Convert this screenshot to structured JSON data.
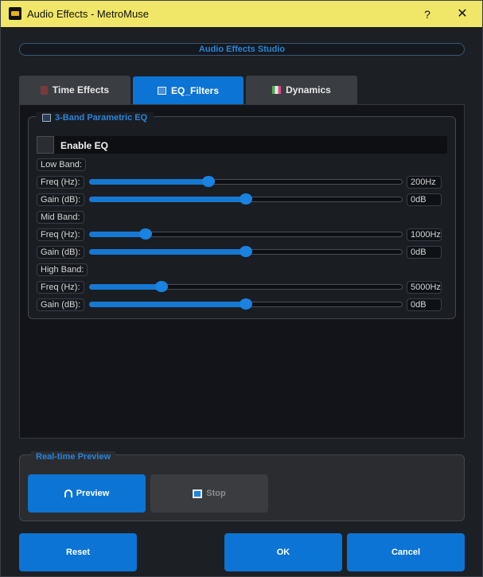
{
  "window": {
    "title": "Audio Effects - MetroMuse",
    "help_label": "?",
    "close_label": "✕"
  },
  "header": {
    "title": "Audio Effects Studio"
  },
  "tabs": [
    {
      "label": "Time Effects",
      "icon": "hourglass-icon",
      "selected": false
    },
    {
      "label": "EQ_Filters",
      "icon": "equalizer-icon",
      "selected": true
    },
    {
      "label": "Dynamics",
      "icon": "dynamics-icon",
      "selected": false
    }
  ],
  "eq": {
    "group_title": "3-Band Parametric EQ",
    "enable_label": "Enable EQ",
    "enabled": false,
    "low": {
      "band_label": "Low Band:",
      "freq_label": "Freq (Hz):",
      "freq_value": "200Hz",
      "freq_level": 0.38,
      "gain_label": "Gain (dB):",
      "gain_value": "0dB",
      "gain_level": 0.5
    },
    "mid": {
      "band_label": "Mid Band:",
      "freq_label": "Freq (Hz):",
      "freq_value": "1000Hz",
      "freq_level": 0.18,
      "gain_label": "Gain (dB):",
      "gain_value": "0dB",
      "gain_level": 0.5
    },
    "high": {
      "band_label": "High Band:",
      "freq_label": "Freq (Hz):",
      "freq_value": "5000Hz",
      "freq_level": 0.23,
      "gain_label": "Gain (dB):",
      "gain_value": "0dB",
      "gain_level": 0.5
    }
  },
  "preview": {
    "group_title": "Real-time Preview",
    "preview_label": "Preview",
    "stop_label": "Stop"
  },
  "footer": {
    "reset_label": "Reset",
    "ok_label": "OK",
    "cancel_label": "Cancel"
  },
  "colors": {
    "accent": "#0c74d4",
    "title_bar": "#f0e668",
    "background": "#1c1f24"
  }
}
